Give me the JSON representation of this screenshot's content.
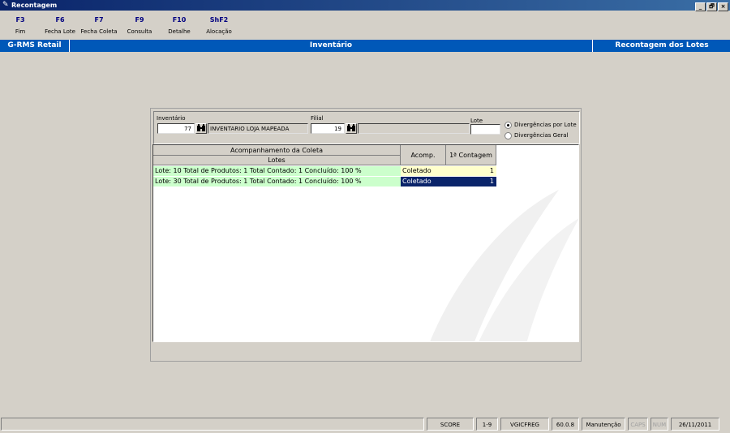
{
  "window": {
    "title": "Recontagem",
    "controls": [
      "_",
      "🗗",
      "×"
    ]
  },
  "toolbar": {
    "keys": [
      {
        "key": "F3",
        "label": "Fim"
      },
      {
        "key": "F6",
        "label": "Fecha Lote"
      },
      {
        "key": "F7",
        "label": "Fecha Coleta"
      },
      {
        "key": "F9",
        "label": "Consulta"
      },
      {
        "key": "F10",
        "label": "Detalhe"
      },
      {
        "key": "ShF2",
        "label": "Alocação"
      }
    ]
  },
  "header": {
    "left": "G-RMS Retail",
    "center": "Inventário",
    "right": "Recontagem dos Lotes"
  },
  "filters": {
    "inventario_label": "Inventário",
    "inventario_value": "77",
    "inventario_desc": "INVENTARIO LOJA MAPEADA",
    "filial_label": "Filial",
    "filial_value": "19",
    "filial_desc": "",
    "lote_label": "Lote",
    "lote_value": "",
    "radio_options": [
      {
        "label": "Divergências por Lote",
        "selected": true
      },
      {
        "label": "Divergências Geral",
        "selected": false
      }
    ]
  },
  "grid": {
    "group_header": "Acompanhamento da Coleta",
    "columns": [
      "Lotes",
      "Acomp.",
      "1ª Contagem"
    ],
    "rows": [
      {
        "lote": "Lote: 10 Total de Produtos: 1 Total Contado: 1 Concluído: 100 %",
        "acomp": "Coletado",
        "contagem": "1",
        "selected": false
      },
      {
        "lote": "Lote: 30 Total de Produtos: 1 Total Contado: 1 Concluído: 100 %",
        "acomp": "Coletado",
        "contagem": "1",
        "selected": true
      }
    ],
    "colors": {
      "lote_bg": "#ccffcc",
      "acomp_bg": "#ffffcc",
      "selected_bg": "#0a246a"
    }
  },
  "statusbar": {
    "cells": [
      {
        "text": "",
        "dim": false
      },
      {
        "text": "SCORE",
        "dim": false
      },
      {
        "text": "1-9",
        "dim": false
      },
      {
        "text": "VGICFREG",
        "dim": false
      },
      {
        "text": "60.0.8",
        "dim": false
      },
      {
        "text": "Manutenção",
        "dim": false
      },
      {
        "text": "CAPS",
        "dim": true
      },
      {
        "text": "NUM",
        "dim": true
      },
      {
        "text": "26/11/2011",
        "dim": false
      }
    ]
  }
}
